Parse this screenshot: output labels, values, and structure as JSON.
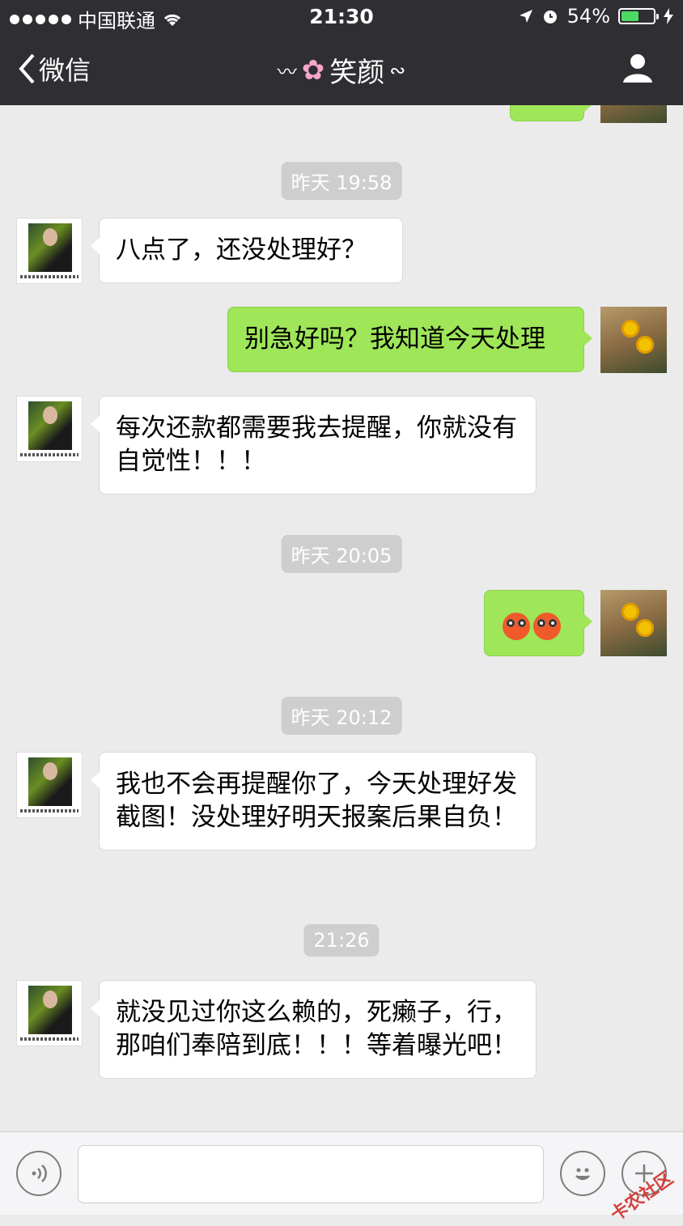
{
  "status_bar": {
    "carrier": "中国联通",
    "time": "21:30",
    "battery_percent": "54%",
    "battery_level": 0.54
  },
  "nav": {
    "back_label": "微信",
    "title": "笑颜",
    "profile_icon": "person-icon"
  },
  "messages": [
    {
      "type": "timestamp",
      "text": "昨天 19:58"
    },
    {
      "type": "incoming",
      "text": "八点了，还没处理好？"
    },
    {
      "type": "outgoing",
      "text": "别急好吗？我知道今天处理"
    },
    {
      "type": "incoming",
      "text": "每次还款都需要我去提醒，你就没有自觉性！！！"
    },
    {
      "type": "timestamp",
      "text": "昨天 20:05"
    },
    {
      "type": "outgoing",
      "text": "",
      "emoji": "flushed-face-emoji x2"
    },
    {
      "type": "timestamp",
      "text": "昨天 20:12"
    },
    {
      "type": "incoming",
      "text": "我也不会再提醒你了，今天处理好发截图！没处理好明天报案后果自负！"
    },
    {
      "type": "timestamp",
      "text": "21:26"
    },
    {
      "type": "incoming",
      "text": "就没见过你这么赖的，死癞子，行，那咱们奉陪到底！！！等着曝光吧！"
    }
  ],
  "input_bar": {
    "voice_icon": "voice-icon",
    "text_value": "",
    "emoji_icon": "smiley-icon",
    "plus_icon": "plus-icon"
  },
  "watermark": "卡农社区",
  "colors": {
    "header_bg": "#2f2f33",
    "chat_bg": "#ebebeb",
    "outgoing_bubble": "#9fe658",
    "incoming_bubble": "#ffffff",
    "timestamp_bg": "#cecece"
  }
}
